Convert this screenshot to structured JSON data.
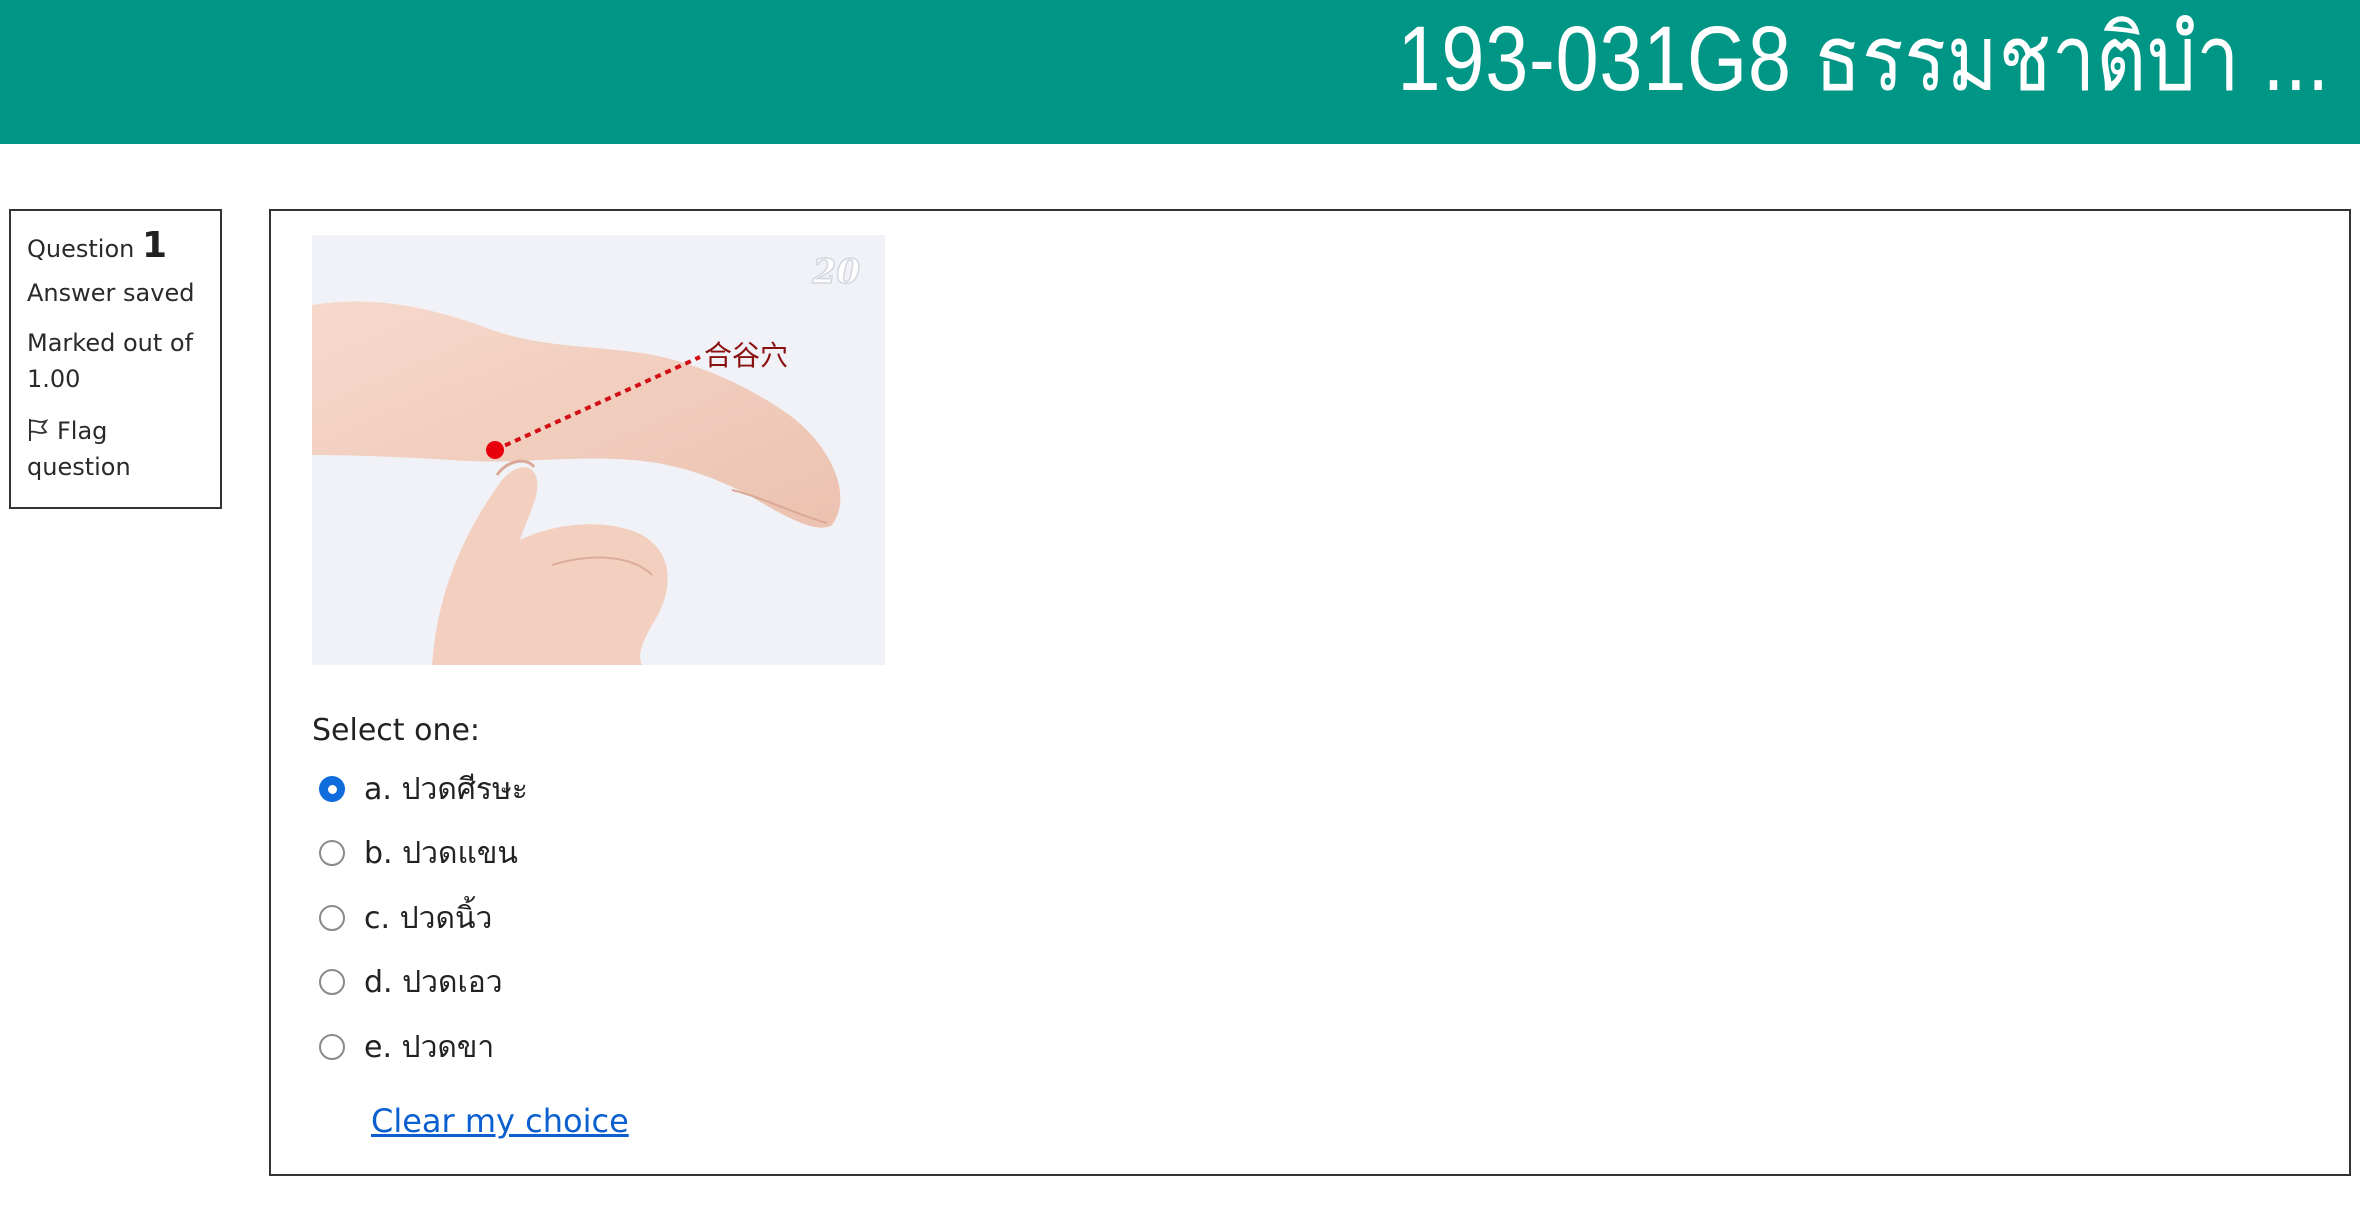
{
  "header": {
    "course_title": "193-031G8 ธรรมชาติบำ ..."
  },
  "question_info": {
    "question_label": "Question",
    "question_number": "1",
    "status": "Answer saved",
    "marked_out_of_label": "Marked out of",
    "marked_out_of_value": "1.00",
    "flag_line1": "Flag",
    "flag_line2": "question"
  },
  "question": {
    "image": {
      "point_label": "合谷穴",
      "watermark": "20",
      "point_color": "#e8000d"
    },
    "prompt": "Select one:",
    "options": [
      {
        "label": "a. ปวดศีรษะ",
        "selected": true
      },
      {
        "label": "b. ปวดแขน",
        "selected": false
      },
      {
        "label": "c. ปวดนิ้ว",
        "selected": false
      },
      {
        "label": "d. ปวดเอว",
        "selected": false
      },
      {
        "label": "e. ปวดขา",
        "selected": false
      }
    ],
    "clear_choice": "Clear my choice"
  },
  "colors": {
    "header_bg": "#009686",
    "radio_selected": "#0f6cdd",
    "link": "#0b5fcf"
  }
}
